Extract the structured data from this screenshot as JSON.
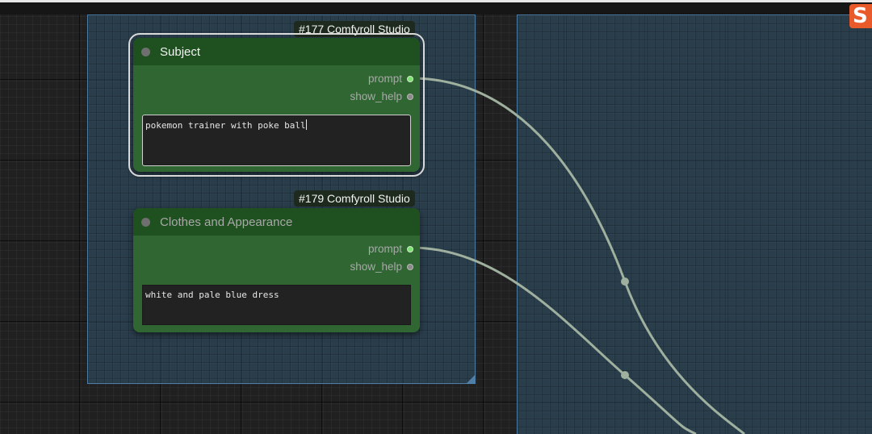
{
  "canvas": {
    "logo_letter": "S",
    "colors": {
      "node_body": "#2f6632",
      "node_header": "#1e511f",
      "group_fill": "#335570",
      "wire": "#9fb09f",
      "output_connected": "#7be46e"
    }
  },
  "nodes": [
    {
      "badge": "#177 Comfyroll Studio",
      "title": "Subject",
      "outputs": [
        "prompt",
        "show_help"
      ],
      "text": "pokemon trainer with poke ball",
      "selected": true
    },
    {
      "badge": "#179 Comfyroll Studio",
      "title": "Clothes and Appearance",
      "outputs": [
        "prompt",
        "show_help"
      ],
      "text": "white and pale blue dress",
      "selected": false
    }
  ]
}
